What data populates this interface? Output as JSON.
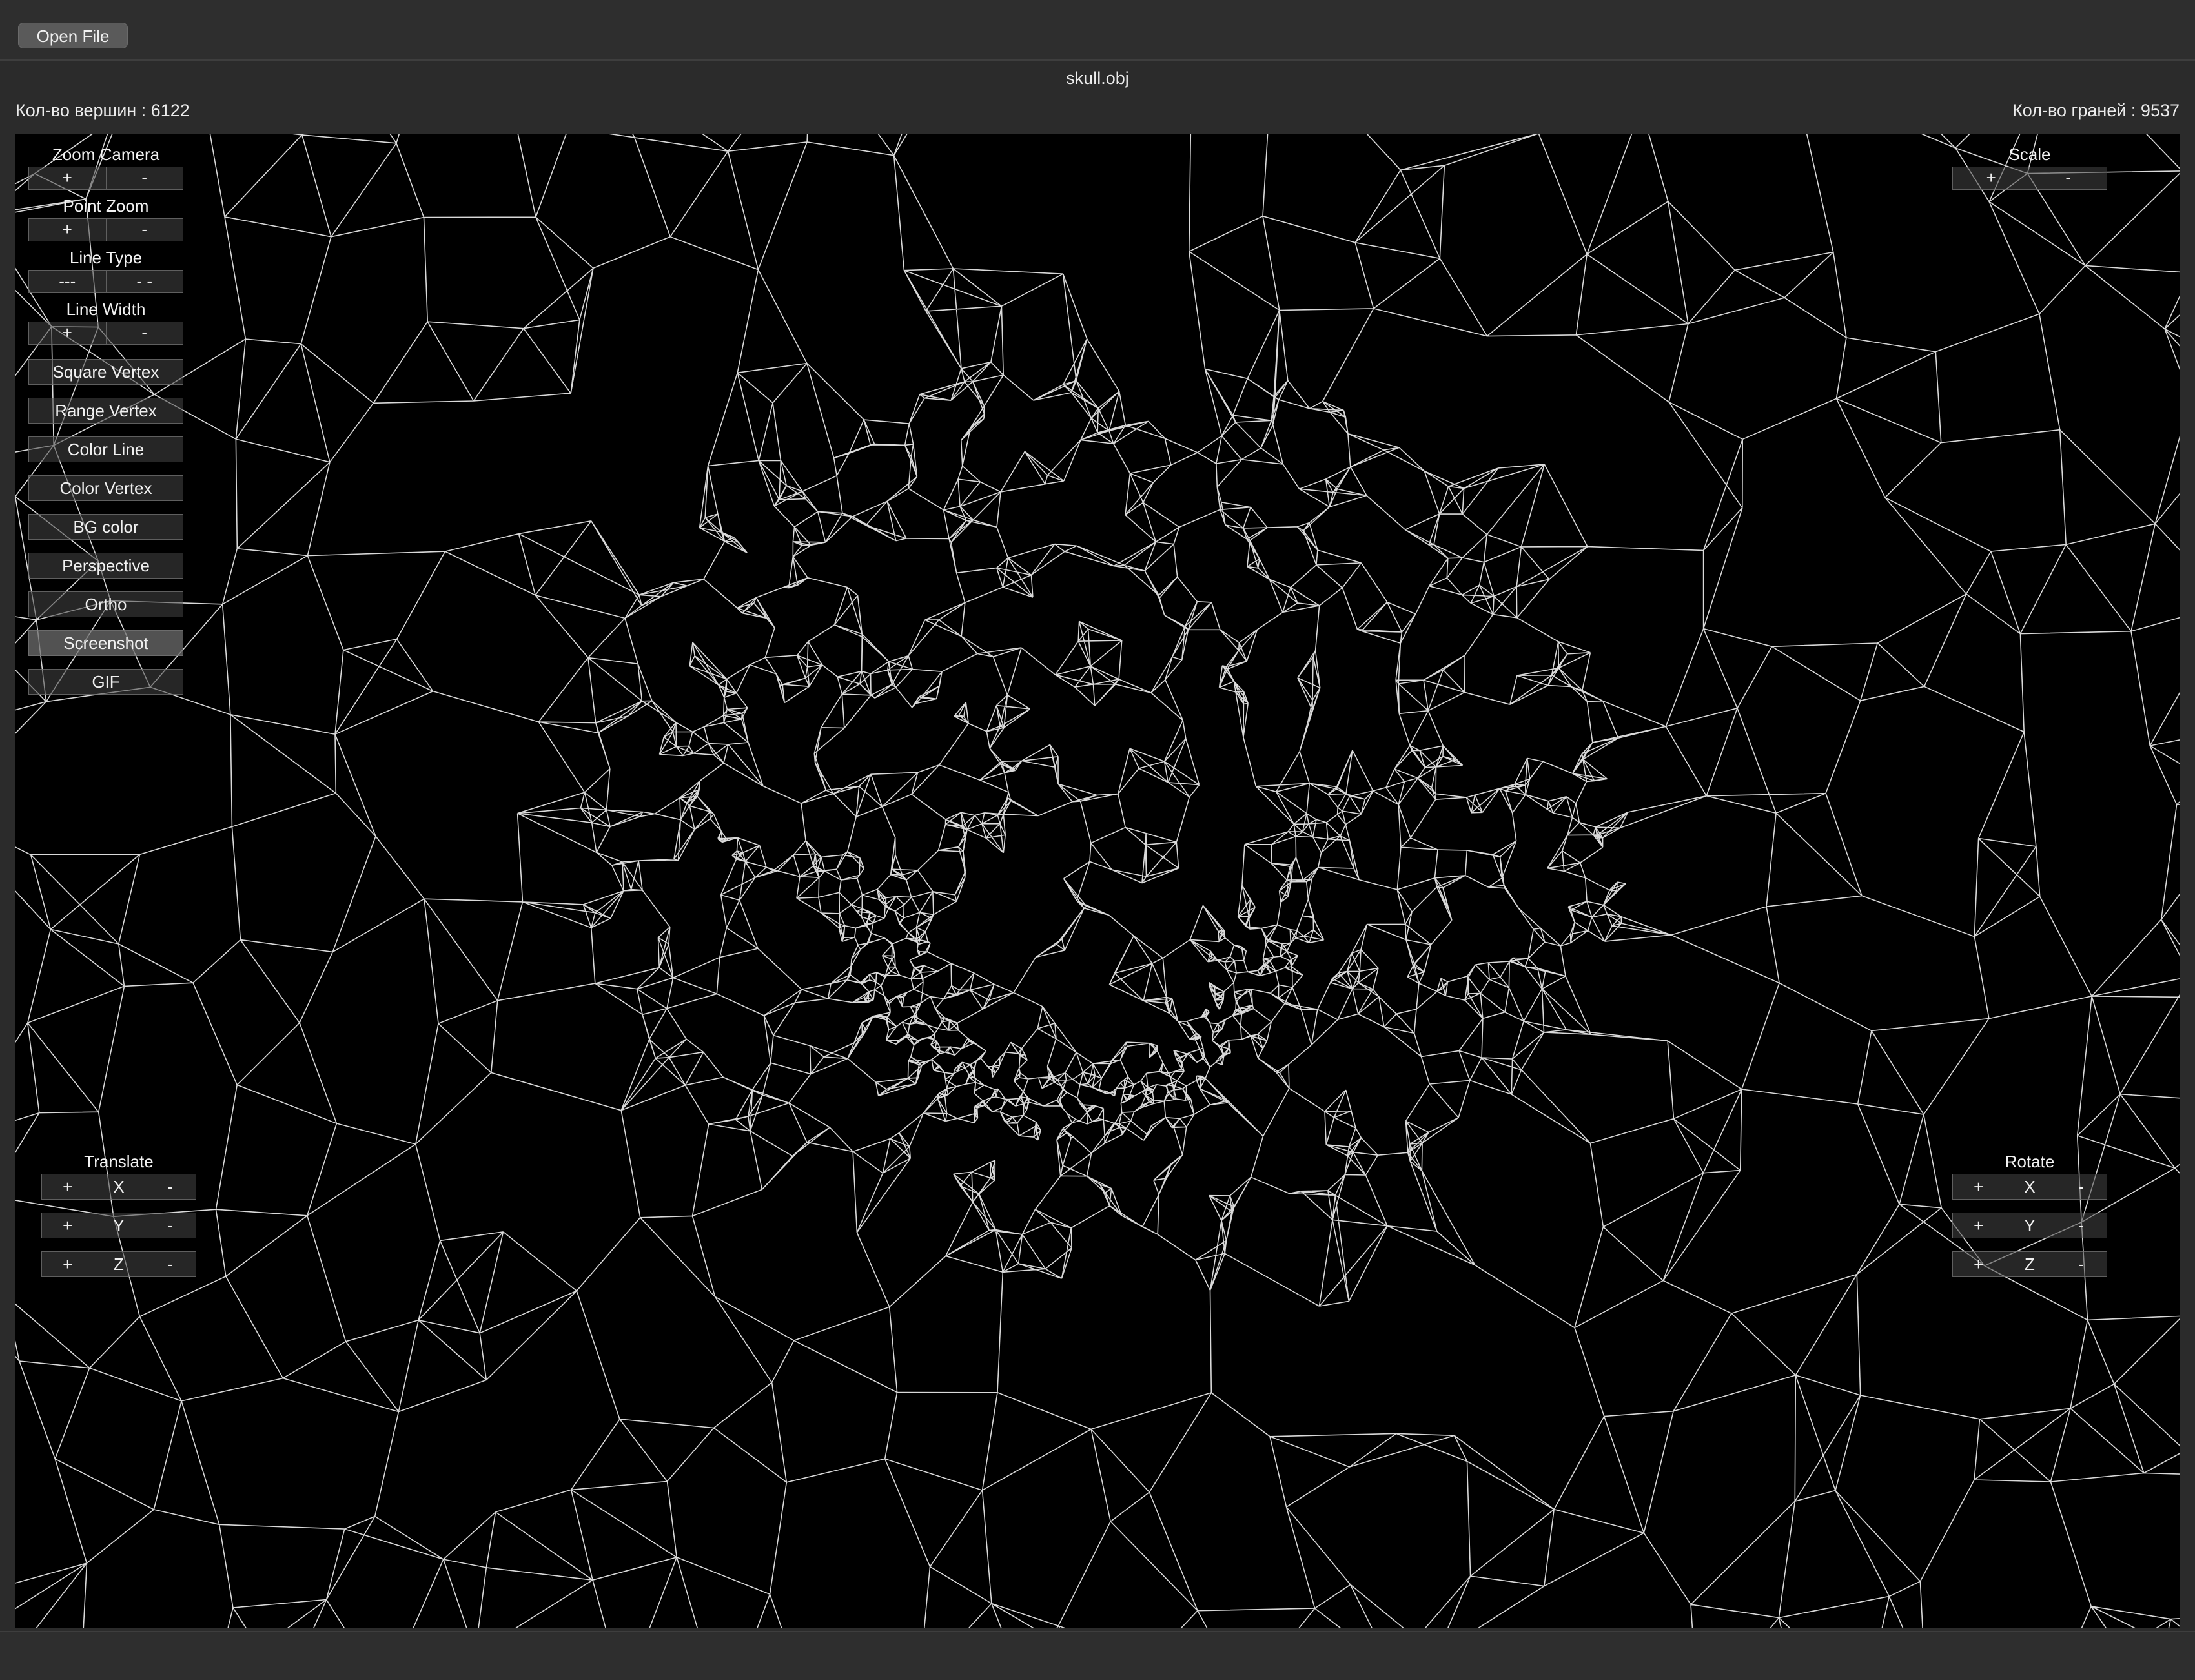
{
  "toolbar": {
    "open_file_label": "Open File"
  },
  "file": {
    "name": "skull.obj"
  },
  "stats": {
    "vertices": "Кол-во вершин : 6122",
    "faces": "Кол-во граней : 9537"
  },
  "left_panel": {
    "zoom_camera": {
      "label": "Zoom Camera",
      "plus": "+",
      "minus": "-"
    },
    "point_zoom": {
      "label": "Point Zoom",
      "plus": "+",
      "minus": "-"
    },
    "line_type": {
      "label": "Line Type",
      "solid": "---",
      "dashed": "- -"
    },
    "line_width": {
      "label": "Line Width",
      "plus": "+",
      "minus": "-"
    },
    "buttons": [
      "Square Vertex",
      "Range Vertex",
      "Color Line",
      "Color Vertex",
      "BG color",
      "Perspective",
      "Ortho",
      "Screenshot",
      "GIF"
    ]
  },
  "scale": {
    "label": "Scale",
    "plus": "+",
    "minus": "-"
  },
  "translate": {
    "label": "Translate",
    "rows": [
      {
        "plus": "+",
        "axis": "X",
        "minus": "-"
      },
      {
        "plus": "+",
        "axis": "Y",
        "minus": "-"
      },
      {
        "plus": "+",
        "axis": "Z",
        "minus": "-"
      }
    ]
  },
  "rotate": {
    "label": "Rotate",
    "rows": [
      {
        "plus": "+",
        "axis": "X",
        "minus": "-"
      },
      {
        "plus": "+",
        "axis": "Y",
        "minus": "-"
      },
      {
        "plus": "+",
        "axis": "Z",
        "minus": "-"
      }
    ]
  },
  "colors": {
    "background": "#000000",
    "line": "#ffffff",
    "window": "#2b2b2b"
  }
}
